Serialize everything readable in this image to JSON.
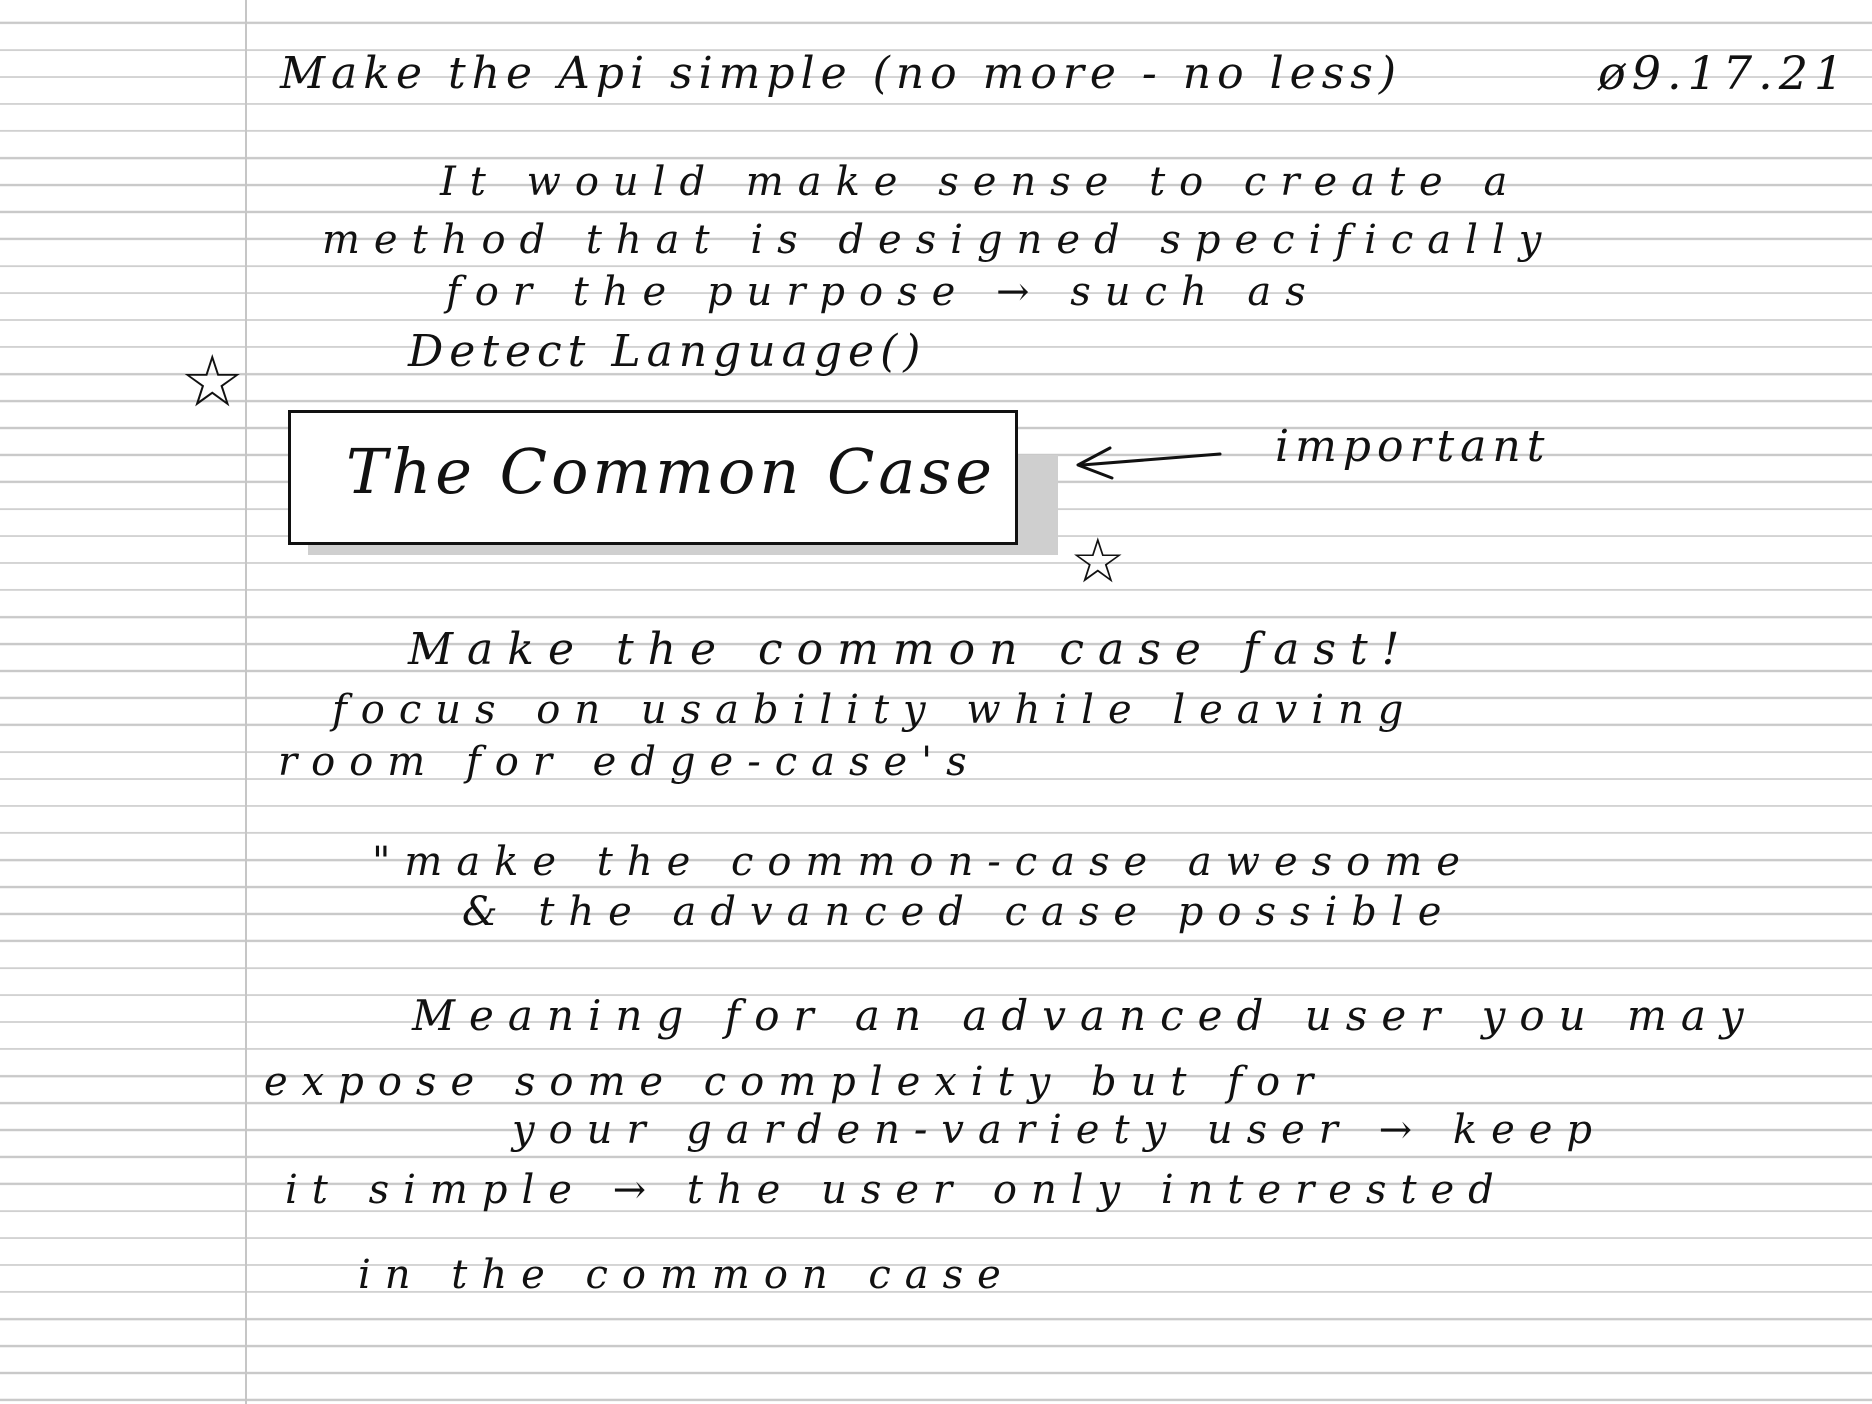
{
  "note": {
    "title": "Make the Api simple (no more - no less)",
    "date": "ø9.17.21",
    "paragraph1": [
      "It would make sense to create a",
      "method that is designed specifically",
      "for the purpose → such as",
      "Detect Language()"
    ],
    "boxed_text": "The Common Case",
    "callout_label": "important",
    "paragraph2": [
      "Make the common case fast!",
      "focus on usability while leaving",
      "room for edge-case's"
    ],
    "quote": [
      "\"make the common-case awesome",
      "& the advanced case possible"
    ],
    "paragraph3": [
      "Meaning for an advanced user you may",
      "expose some complexity but for",
      "your garden-variety user → keep",
      "it simple → the user only interested",
      "in the common case"
    ]
  },
  "marks": {
    "star_glyph": "☆",
    "arrow_icon": "left-arrow-icon",
    "ink_color": "#111111",
    "rule_color": "#c9c9c9",
    "box_shadow_color": "#cfcfcf"
  }
}
